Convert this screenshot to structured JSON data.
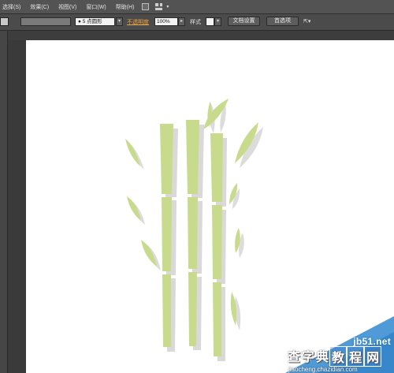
{
  "menu": {
    "items": [
      "选择(S)",
      "效果(C)",
      "视图(V)",
      "窗口(W)",
      "帮助(H)"
    ]
  },
  "control_bar": {
    "brush_value": "● 5 点圆形",
    "opacity_label": "不透明度",
    "opacity_value": "100%",
    "style_label": "样式",
    "document_setup_label": "文档设置",
    "preferences_label": "首选项",
    "arrange_symbol": "⇱▾"
  },
  "watermark": {
    "site": "jb51.net",
    "chars": [
      "查",
      "字",
      "典",
      "教",
      "程",
      "网"
    ],
    "url": "jiaocheng.chazidian.com"
  },
  "colors": {
    "bamboo": "#c8db8c",
    "shadow": "#d6d6d6",
    "canvas": "#ffffff",
    "workspace": "#3a3a3a",
    "watermark_blue": "#3c8fd3"
  }
}
